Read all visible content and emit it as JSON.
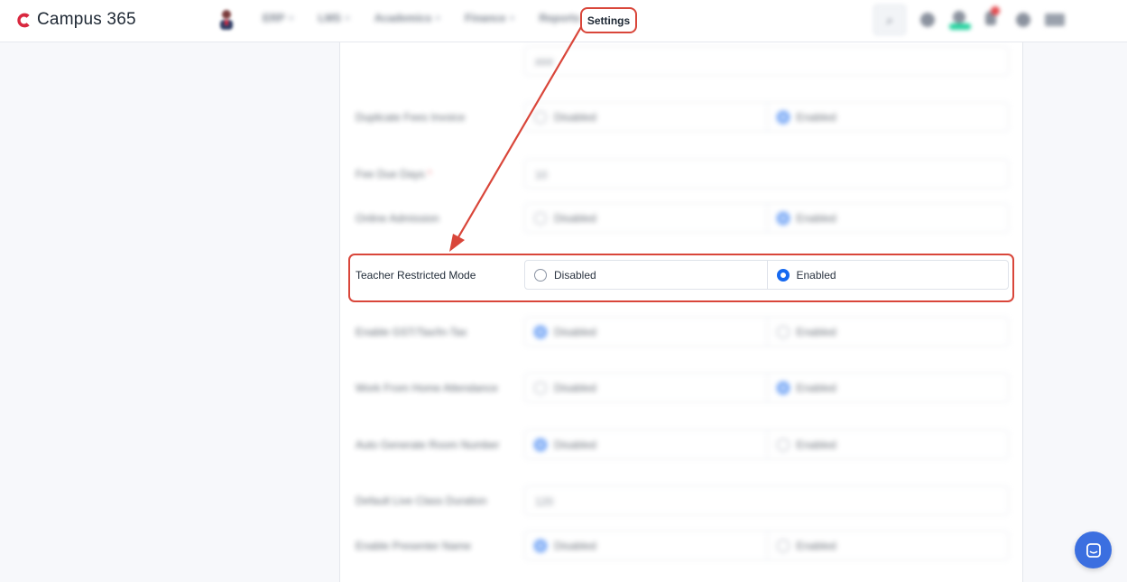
{
  "brand": {
    "name": "Campus 365",
    "logo_icon": "campus-logo-icon",
    "accent": "#d9283f"
  },
  "nav": {
    "items": [
      {
        "label": "ERP"
      },
      {
        "label": "LMS"
      },
      {
        "label": "Academics"
      },
      {
        "label": "Finance"
      },
      {
        "label": "Reports"
      }
    ],
    "active_label": "Settings"
  },
  "toolbar": {
    "icons": [
      "search-icon",
      "globe-icon",
      "user-status-icon",
      "notification-bell-icon",
      "help-icon",
      "language-flag-icon",
      "user-avatar-icon"
    ]
  },
  "settings": {
    "top_field_value": "###",
    "rows": [
      {
        "label": "Duplicate Fees Invoice",
        "opt1": "Disabled",
        "opt2": "Enabled"
      },
      {
        "label": "Fee Due Days",
        "value": "10"
      },
      {
        "label": "Online Admission",
        "opt1": "Disabled",
        "opt2": "Enabled"
      },
      {
        "label": "Teacher Restricted Mode",
        "opt1": "Disabled",
        "opt2": "Enabled"
      },
      {
        "label": "Enable GST/Tax/In-Tax",
        "opt1": "Disabled",
        "opt2": "Enabled"
      },
      {
        "label": "Work From Home Attendance",
        "opt1": "Disabled",
        "opt2": "Enabled"
      },
      {
        "label": "Auto Generate Room Number",
        "opt1": "Disabled",
        "opt2": "Enabled"
      },
      {
        "label": "Default Live Class Duration",
        "value": "120"
      },
      {
        "label": "Enable Presenter Name",
        "opt1": "Disabled",
        "opt2": "Enabled"
      }
    ]
  },
  "colors": {
    "highlight": "#d9463a",
    "radio_checked": "#1669f0",
    "chat": "#3b6fe0"
  }
}
